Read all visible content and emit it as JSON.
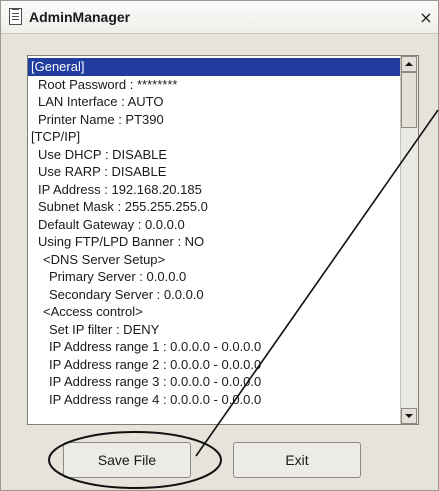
{
  "window": {
    "title": "AdminManager",
    "close_glyph": "×"
  },
  "settings_list": {
    "items": [
      {
        "text": "[General]",
        "indent": 0,
        "selected": true
      },
      {
        "text": "Root Password : ********",
        "indent": 1
      },
      {
        "text": "LAN Interface : AUTO",
        "indent": 1
      },
      {
        "text": "Printer Name : PT390",
        "indent": 1
      },
      {
        "text": "[TCP/IP]",
        "indent": 0
      },
      {
        "text": "Use DHCP : DISABLE",
        "indent": 1
      },
      {
        "text": "Use RARP : DISABLE",
        "indent": 1
      },
      {
        "text": "IP Address : 192.168.20.185",
        "indent": 1
      },
      {
        "text": "Subnet Mask : 255.255.255.0",
        "indent": 1
      },
      {
        "text": "Default Gateway : 0.0.0.0",
        "indent": 1
      },
      {
        "text": "Using FTP/LPD Banner : NO",
        "indent": 1
      },
      {
        "text": "<DNS Server Setup>",
        "indent": 2
      },
      {
        "text": "Primary Server : 0.0.0.0",
        "indent": 3
      },
      {
        "text": "Secondary Server : 0.0.0.0",
        "indent": 3
      },
      {
        "text": "<Access control>",
        "indent": 2
      },
      {
        "text": "Set IP filter : DENY",
        "indent": 3
      },
      {
        "text": "IP Address range 1 : 0.0.0.0 - 0.0.0.0",
        "indent": 3
      },
      {
        "text": "IP Address range 2 : 0.0.0.0 - 0.0.0.0",
        "indent": 3
      },
      {
        "text": "IP Address range 3 : 0.0.0.0 - 0.0.0.0",
        "indent": 3
      },
      {
        "text": "IP Address range 4 : 0.0.0.0 - 0.0.0.0",
        "indent": 3
      }
    ]
  },
  "buttons": {
    "save_label": "Save File",
    "exit_label": "Exit"
  },
  "icons": {
    "title": "document-icon",
    "close": "close-icon",
    "scroll_up": "arrow-up-icon",
    "scroll_down": "arrow-down-icon"
  },
  "colors": {
    "selection": "#1f3c9e",
    "window_bg": "#e6e3db"
  }
}
